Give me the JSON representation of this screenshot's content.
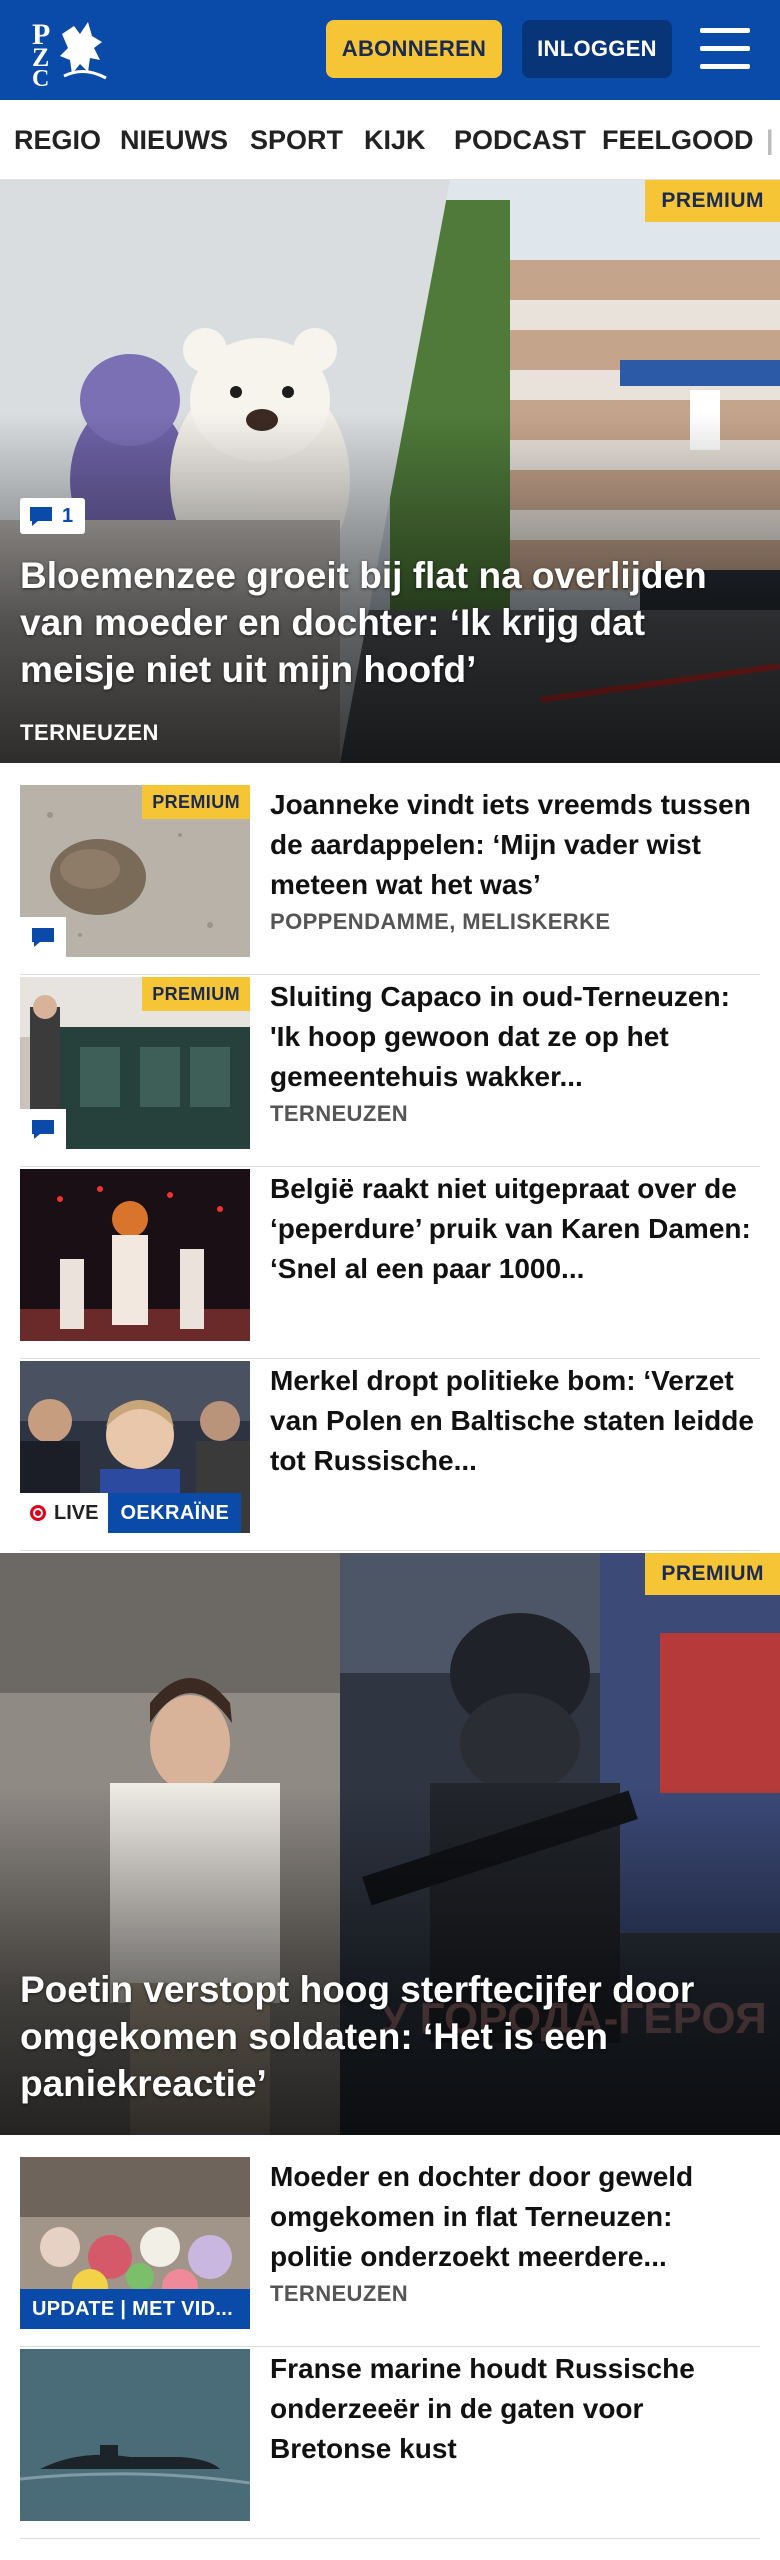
{
  "header": {
    "logo_text": "PZC",
    "subscribe_label": "ABONNEREN",
    "login_label": "INLOGGEN",
    "menu_icon": "hamburger-menu-icon",
    "brand_color": "#0a4aa8",
    "accent_color": "#f6c536"
  },
  "nav": {
    "items": [
      "REGIO",
      "NIEUWS",
      "SPORT",
      "KIJK",
      "PODCAST",
      "FEELGOOD"
    ]
  },
  "hero1": {
    "premium_label": "PREMIUM",
    "comment_count": "1",
    "title": "Bloemenzee groeit bij flat na overlijden van moeder en dochter: ‘Ik krijg dat meisje niet uit mijn hoofd’",
    "location": "TERNEUZEN"
  },
  "articles": [
    {
      "title": "Joanneke vindt iets vreemds tussen de aardappelen: ‘Mijn vader wist meteen wat het was’",
      "location": "POPPENDAMME, MELISKERKE",
      "premium_label": "PREMIUM"
    },
    {
      "title": "Sluiting Capaco in oud-Terneuzen: 'Ik hoop gewoon dat ze op het gemeentehuis wakker...",
      "location": "TERNEUZEN",
      "premium_label": "PREMIUM"
    },
    {
      "title": "België raakt niet uitgepraat over de ‘peperdure’ pruik van Karen Damen: ‘Snel al een paar 1000..."
    },
    {
      "title": "Merkel dropt politieke bom: ‘Verzet van Polen en Baltische staten leidde tot Russische...",
      "live_label": "LIVE",
      "tag_label": "OEKRAÏNE"
    }
  ],
  "hero2": {
    "premium_label": "PREMIUM",
    "title": "Poetin verstopt hoog sterftecijfer door omgekomen soldaten: ‘Het is een paniekreactie’"
  },
  "articles2": [
    {
      "title": "Moeder en dochter door geweld omgekomen in flat Terneuzen: politie onderzoekt meerdere...",
      "location": "TERNEUZEN",
      "update_label": "UPDATE | MET VID..."
    },
    {
      "title": "Franse marine houdt Russische onderzeeër in de gaten voor Bretonse kust"
    }
  ]
}
